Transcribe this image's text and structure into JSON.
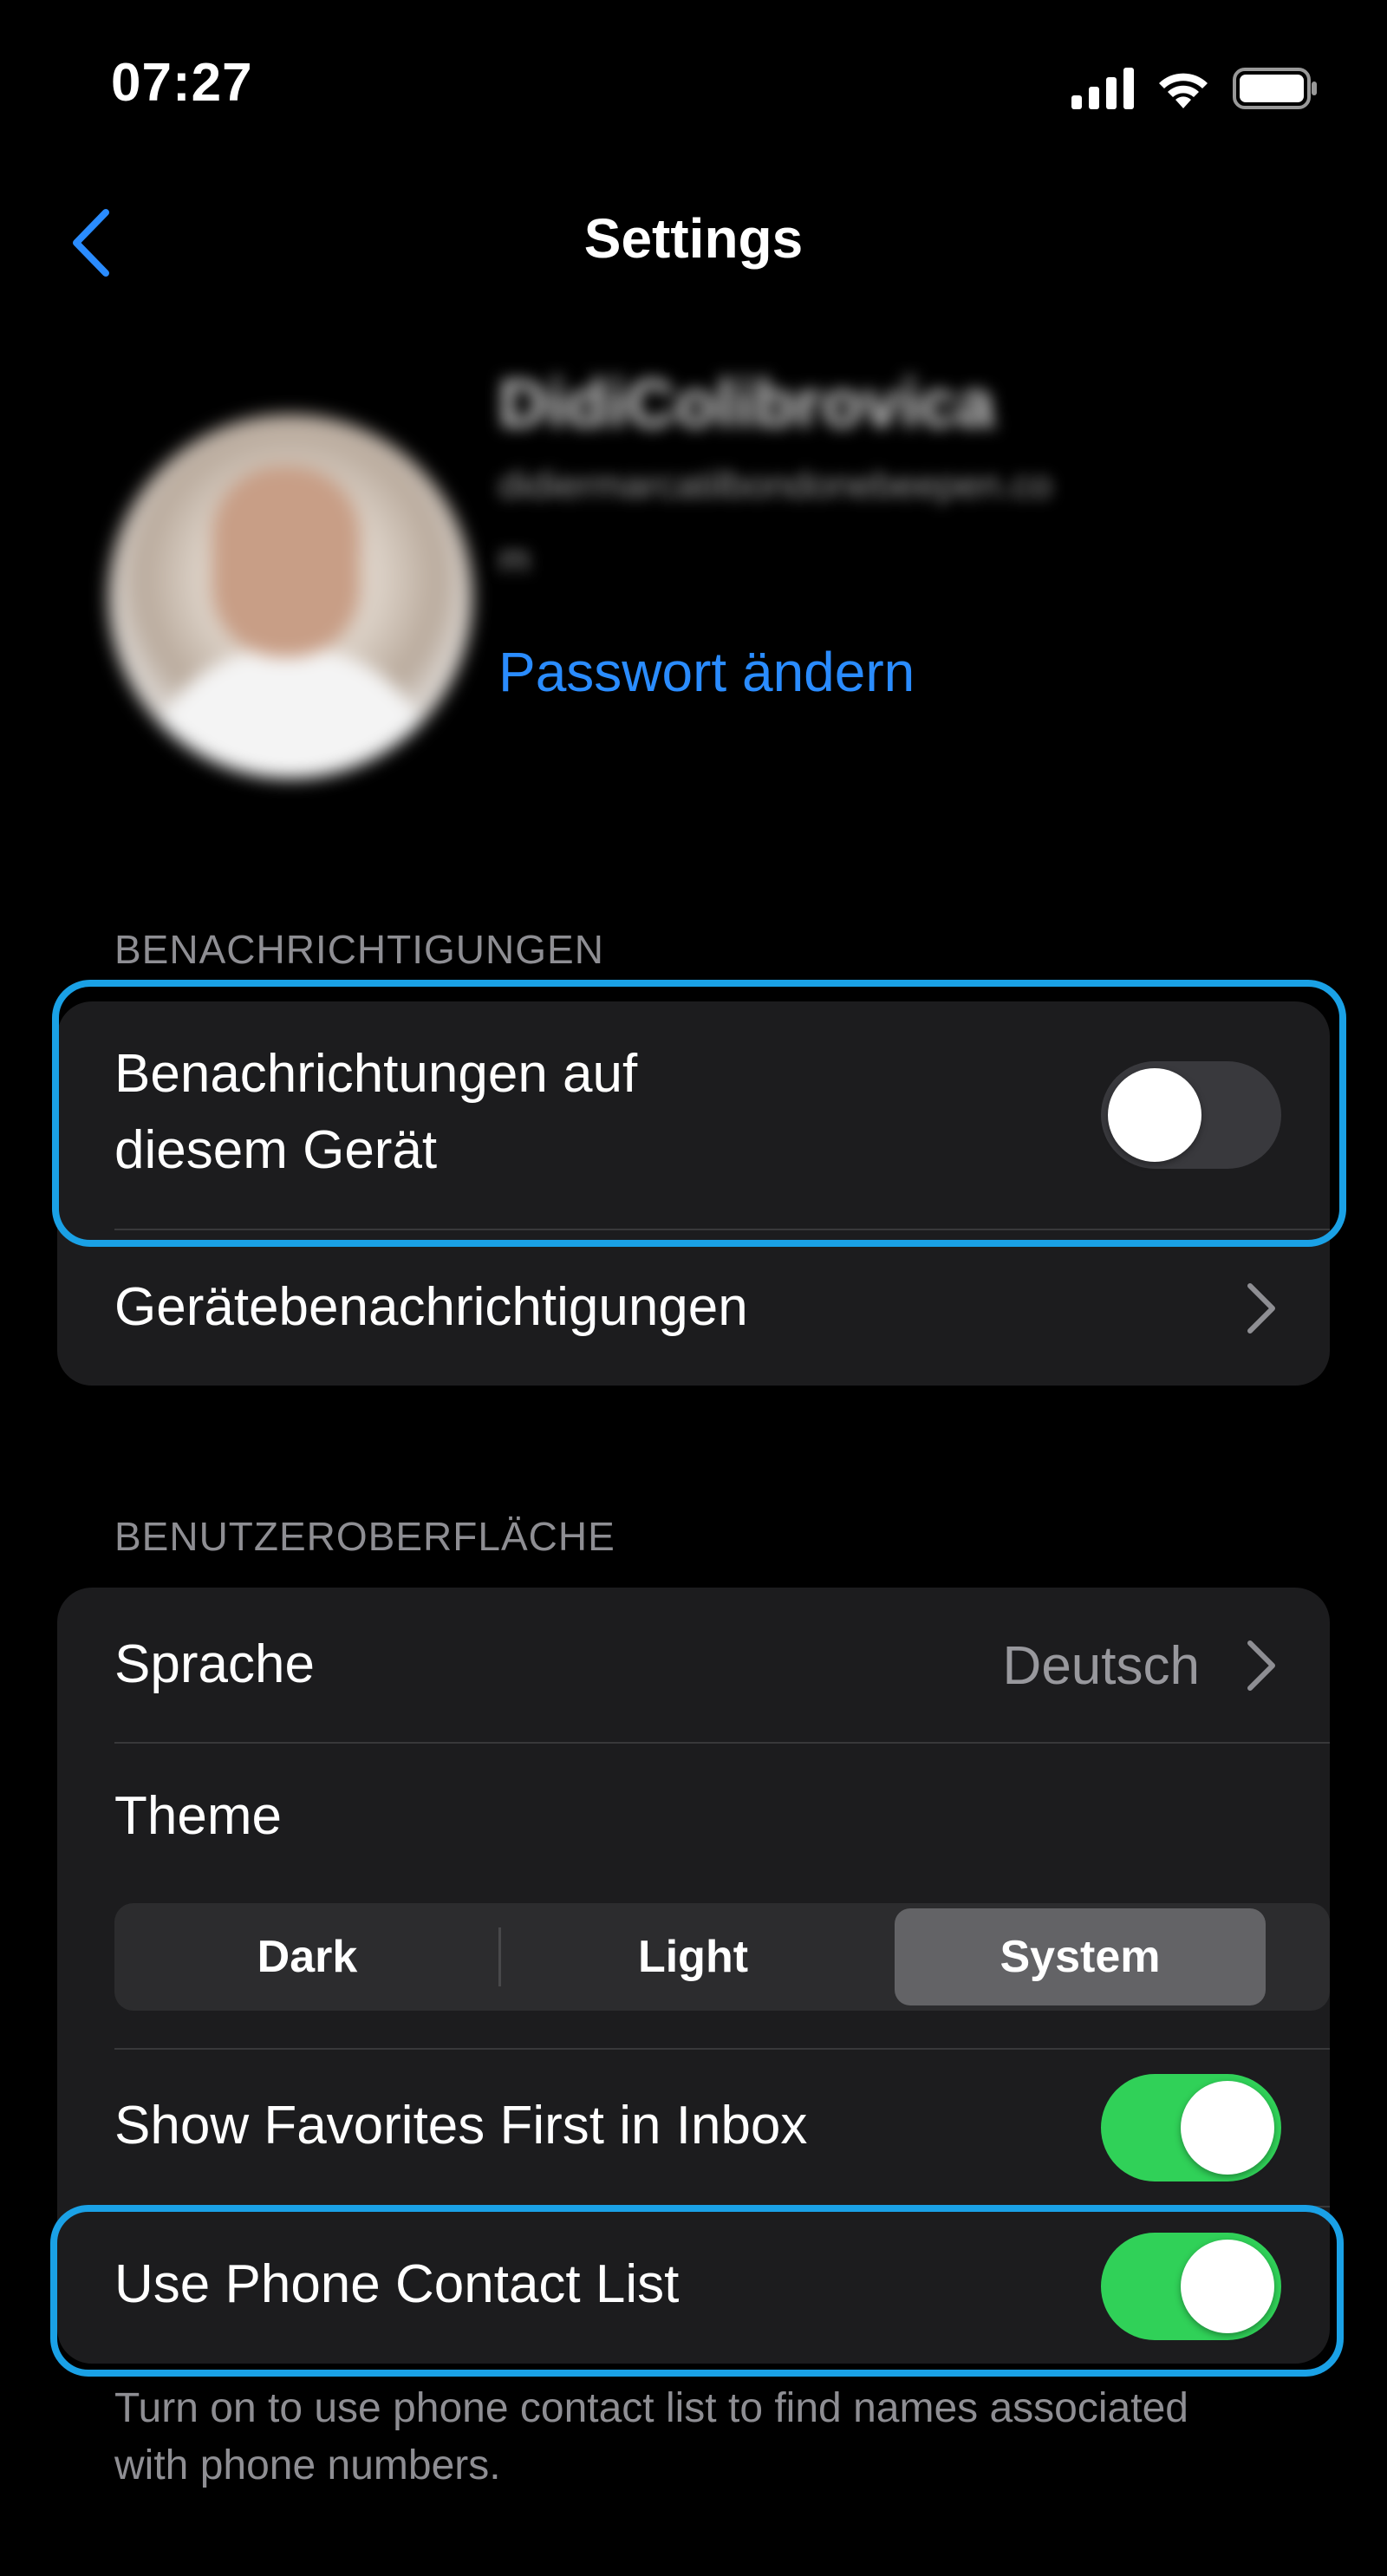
{
  "status_bar": {
    "time": "07:27",
    "icons": [
      "cellular-signal-icon",
      "wifi-icon",
      "battery-icon"
    ]
  },
  "nav": {
    "title": "Settings",
    "back_icon": "chevron-left-icon"
  },
  "profile": {
    "name": "DidiColibrovica",
    "email": "didiermarcatilbondonebeepen.co",
    "email_cont": "m",
    "change_password_link": "Passwort ändern"
  },
  "sections": {
    "notifications": {
      "header": "BENACHRICHTIGUNGEN",
      "device_notifications_label_line1": "Benachrichtungen auf",
      "device_notifications_label_line2": "diesem Gerät",
      "device_notifications_enabled": false,
      "device_settings_label": "Gerätebenachrichtigungen"
    },
    "interface": {
      "header": "BENUTZEROBERFLÄCHE",
      "language_label": "Sprache",
      "language_value": "Deutsch",
      "theme_label": "Theme",
      "theme_options": [
        "Dark",
        "Light",
        "System"
      ],
      "theme_selected": "System",
      "favorites_first_label": "Show Favorites First in Inbox",
      "favorites_first_enabled": true,
      "phone_contacts_label": "Use Phone Contact List",
      "phone_contacts_enabled": true,
      "phone_contacts_footer": "Turn on to use phone contact list to find names associated with phone numbers."
    }
  },
  "colors": {
    "background": "#000000",
    "group_background": "#1c1c1e",
    "accent_blue": "#2a8cff",
    "toggle_on": "#30d158",
    "highlight_outline": "#1aa1e6"
  }
}
